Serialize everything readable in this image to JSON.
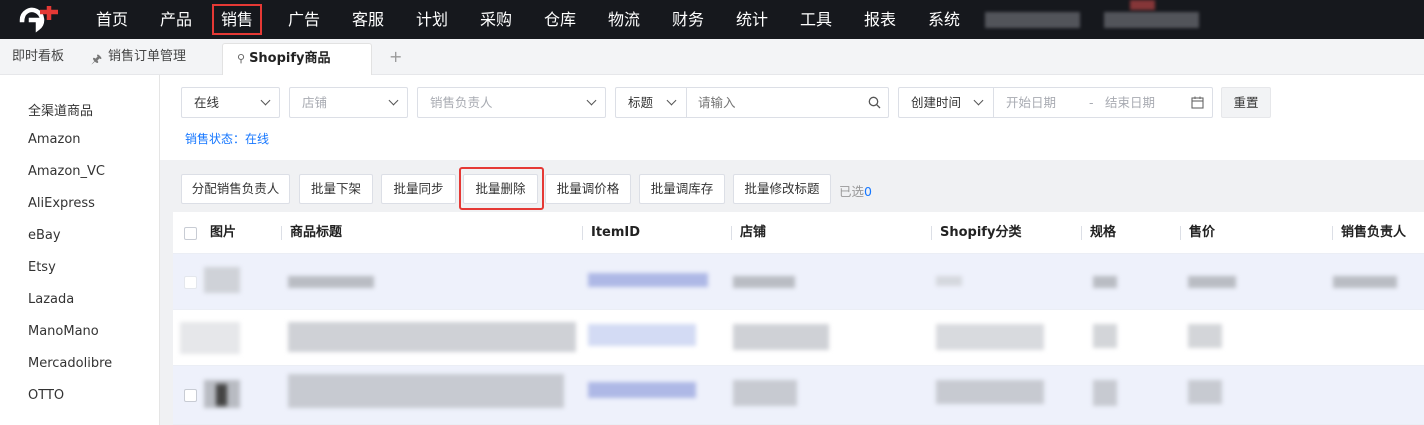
{
  "nav": {
    "items": [
      "首页",
      "产品",
      "销售",
      "广告",
      "客服",
      "计划",
      "采购",
      "仓库",
      "物流",
      "财务",
      "统计",
      "工具",
      "报表",
      "系统"
    ],
    "active": "销售"
  },
  "tabs": {
    "dashboard": "即时看板",
    "orders": "销售订单管理",
    "shopify": "Shopify商品",
    "add": "+"
  },
  "sidebar": {
    "items": [
      "全渠道商品",
      "Amazon",
      "Amazon_VC",
      "AliExpress",
      "eBay",
      "Etsy",
      "Lazada",
      "ManoMano",
      "Mercadolibre",
      "OTTO"
    ]
  },
  "filters": {
    "status_value": "在线",
    "store_placeholder": "店铺",
    "owner_placeholder": "销售负责人",
    "title_field": "标题",
    "search_placeholder": "请输入",
    "time_field": "创建时间",
    "start_placeholder": "开始日期",
    "range_sep": "-",
    "end_placeholder": "结束日期",
    "reset_label": "重置",
    "status_tag": "销售状态：在线"
  },
  "actions": {
    "assign_owner": "分配销售负责人",
    "bulk_unlist": "批量下架",
    "bulk_sync": "批量同步",
    "bulk_delete": "批量删除",
    "bulk_price": "批量调价格",
    "bulk_stock": "批量调库存",
    "bulk_title": "批量修改标题",
    "selected_label": "已选",
    "selected_count": "0"
  },
  "table": {
    "columns": [
      "图片",
      "商品标题",
      "ItemID",
      "店铺",
      "Shopify分类",
      "规格",
      "售价",
      "销售负责人"
    ]
  },
  "colors": {
    "topbar": "#16181d",
    "accent_blue": "#1677ff",
    "highlight_red": "#e53935"
  }
}
